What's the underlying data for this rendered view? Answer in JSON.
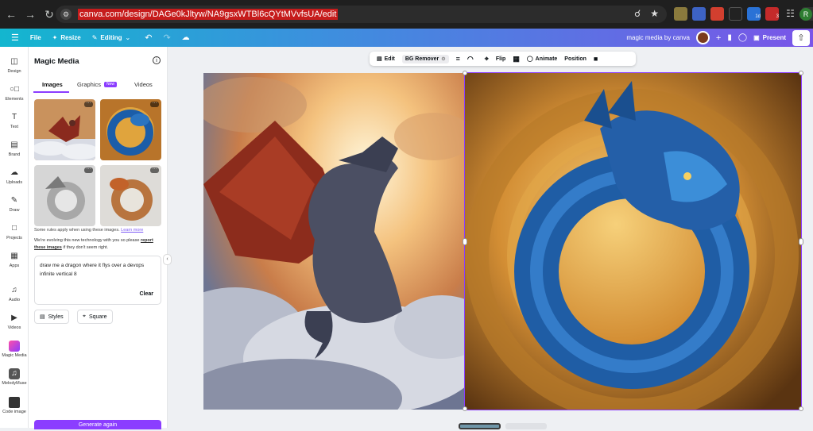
{
  "browser": {
    "url": "canva.com/design/DAGe0kJltyw/NA9gsxWTBl6cQYtMVvfsUA/edit",
    "profile_initial": "R",
    "ext_badges": [
      "1d",
      "3"
    ]
  },
  "topbar": {
    "file": "File",
    "resize": "Resize",
    "editing": "Editing",
    "design_title": "magic media by canva",
    "present": "Present"
  },
  "rail": [
    {
      "label": "Design",
      "icon": "design-icon"
    },
    {
      "label": "Elements",
      "icon": "elements-icon"
    },
    {
      "label": "Text",
      "icon": "text-icon"
    },
    {
      "label": "Brand",
      "icon": "brand-icon"
    },
    {
      "label": "Uploads",
      "icon": "uploads-icon"
    },
    {
      "label": "Draw",
      "icon": "draw-icon"
    },
    {
      "label": "Projects",
      "icon": "projects-icon"
    },
    {
      "label": "Apps",
      "icon": "apps-icon"
    },
    {
      "label": "Audio",
      "icon": "audio-icon"
    },
    {
      "label": "Videos",
      "icon": "videos-icon"
    },
    {
      "label": "Magic Media",
      "icon": "magic-media-icon"
    },
    {
      "label": "MelodyMuse",
      "icon": "melodymuse-icon"
    },
    {
      "label": "Code image",
      "icon": "code-image-icon"
    }
  ],
  "panel": {
    "title": "Magic Media",
    "tabs": [
      "Images",
      "Graphics",
      "Videos"
    ],
    "new_badge": "New",
    "rules_text": "Some rules apply when using these images.",
    "learn_more": "Learn more",
    "evolve_text_1": "We're evolving this new technology with you so please",
    "report_link": "report these images",
    "evolve_text_2": "if they don't seem right.",
    "prompt": "draw me a dragon where it flys over a devops infinite vertical 8",
    "clear": "Clear",
    "style_chip": "Styles",
    "ratio_chip": "Square",
    "generate": "Generate again"
  },
  "toolbar": {
    "edit": "Edit",
    "bg_remover": "BG Remover",
    "flip": "Flip",
    "animate": "Animate",
    "position": "Position"
  },
  "colors": {
    "accent": "#8b3dff",
    "url_highlight": "#c61c1c"
  }
}
